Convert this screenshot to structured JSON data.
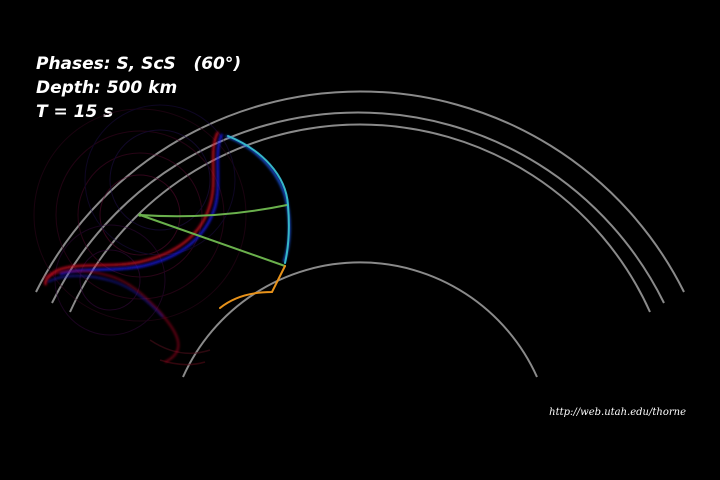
{
  "labels": {
    "phases": "Phases: S, ScS   (60°)",
    "depth": "Depth: 500 km",
    "time": "T = 15 s",
    "credit": "http://web.utah.edu/thorne"
  },
  "colors": {
    "background": "#000000",
    "boundaries": "#8a8a8a",
    "wavefront_red": "#d01020",
    "wavefront_blue": "#1a1aff",
    "ray_S": "#6ab04c",
    "ray_ScS_down": "#e8921a",
    "ray_ScS_up": "#36b7c8",
    "text": "#ffffff"
  }
}
